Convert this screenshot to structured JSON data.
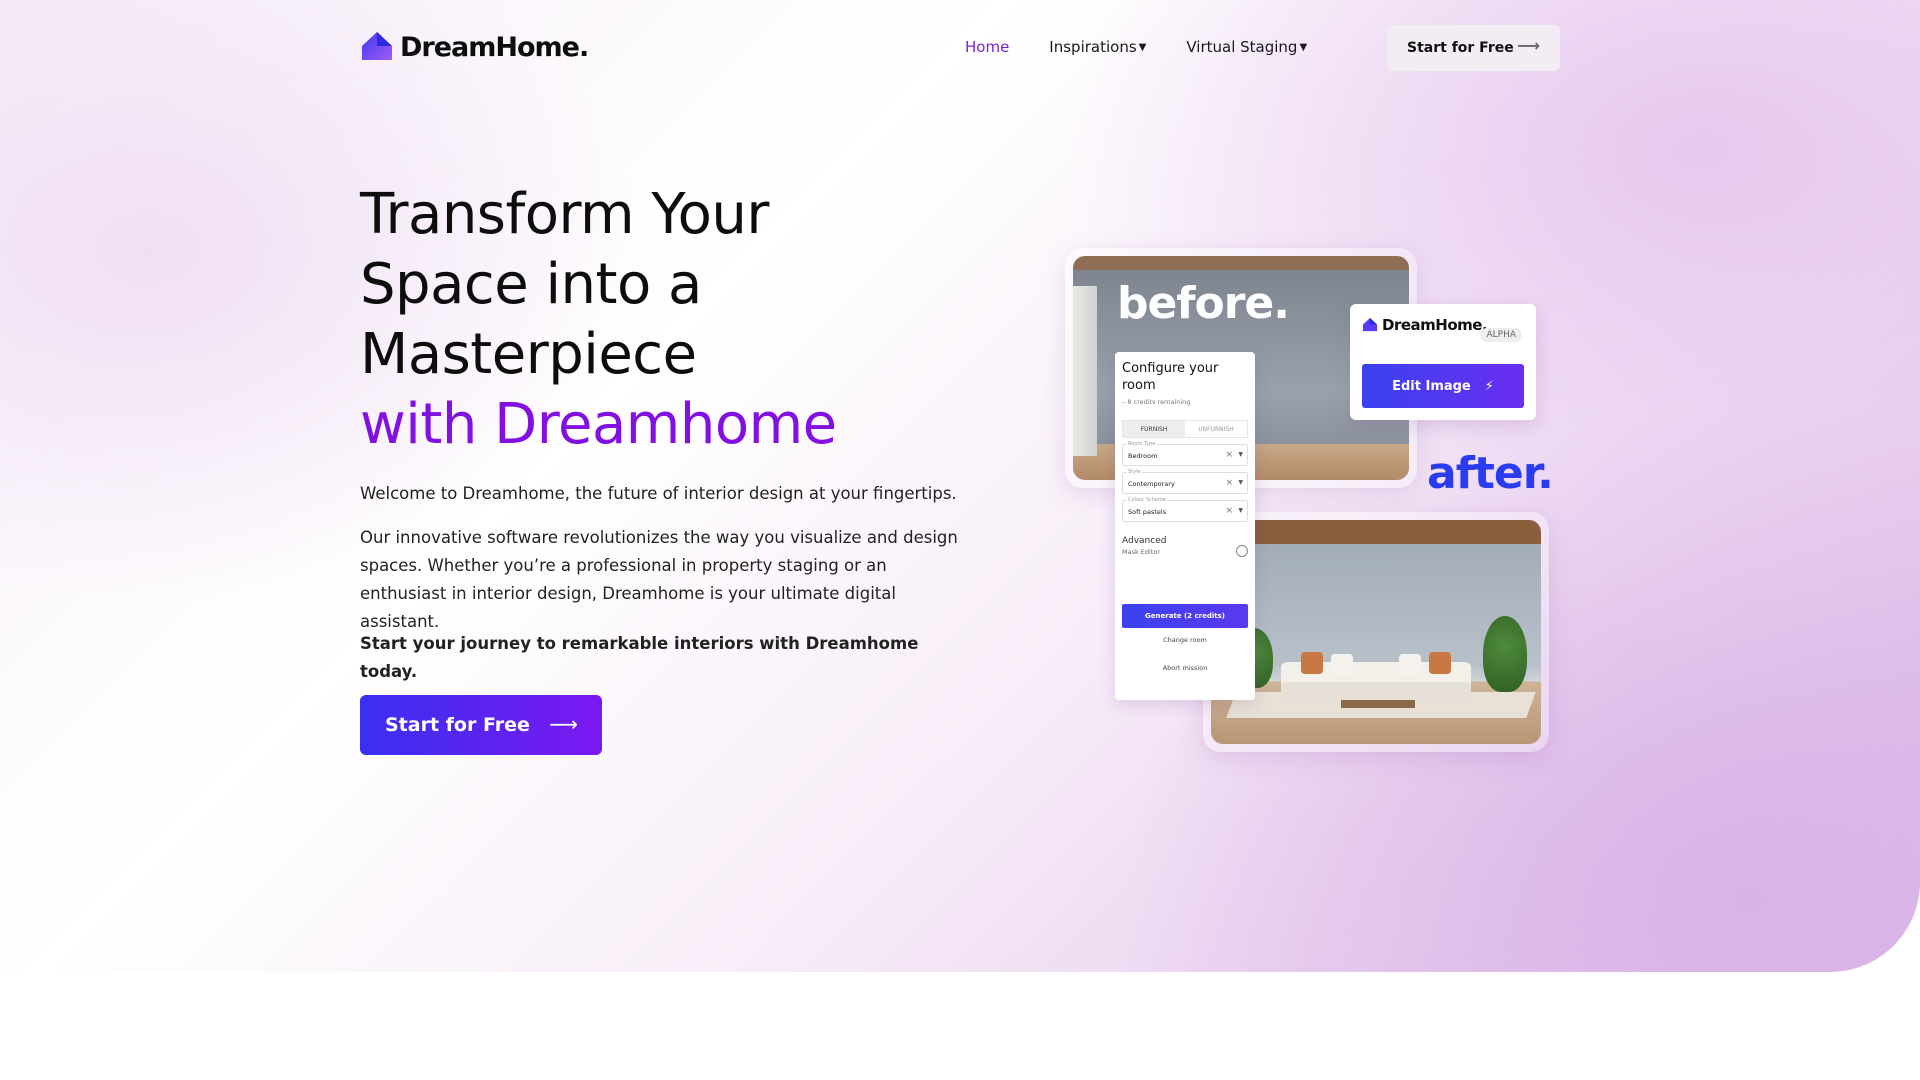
{
  "brand": {
    "name": "DreamHome.",
    "accent": "#7a1fd6"
  },
  "nav": {
    "links": [
      {
        "label": "Home",
        "active": true
      },
      {
        "label": "Inspirations",
        "dropdown": true
      },
      {
        "label": "Virtual Staging",
        "dropdown": true
      }
    ],
    "cta_label": "Start for Free",
    "cta_icon": "arrow-right-icon"
  },
  "hero": {
    "headline_lines": [
      "Transform Your",
      "Space into a",
      "Masterpiece"
    ],
    "headline_accent": "with Dreamhome",
    "para1": "Welcome to Dreamhome, the future of interior design at your fingertips.",
    "para2": "Our innovative software revolutionizes the way you visualize and design spaces. Whether you’re a professional in property staging or an enthusiast in interior design, Dreamhome is your ultimate digital assistant.",
    "para3": "Start your journey to remarkable interiors with Dreamhome today.",
    "cta_label": "Start for Free",
    "cta_gradient": [
      "#3a30f0",
      "#7b18f0"
    ]
  },
  "mockup": {
    "before_label": "before.",
    "after_label": "after.",
    "brand_card": {
      "logo": "DreamHome.",
      "badge": "ALPHA",
      "button": "Edit Image",
      "button_icon": "bolt-icon"
    },
    "config": {
      "title": "Configure your room",
      "credits": "– 8 credits remaining",
      "tabs": [
        "FURNISH",
        "UNFURNISH"
      ],
      "fields": [
        {
          "label": "Room Type",
          "value": "Bedroom"
        },
        {
          "label": "Style",
          "value": "Contemporary"
        },
        {
          "label": "Colour Scheme",
          "value": "Soft pastels"
        }
      ],
      "advanced": "Advanced",
      "mask_editor": "Mask Editor",
      "generate": "Generate (2 credits)",
      "change_room": "Change room",
      "abort": "Abort mission"
    }
  }
}
